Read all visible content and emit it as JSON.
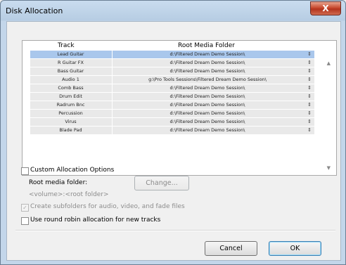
{
  "window": {
    "title": "Disk Allocation",
    "close_symbol": "X"
  },
  "table": {
    "col_track": "Track",
    "col_folder": "Root Media Folder",
    "rows": [
      {
        "track": "Lead Guitar",
        "folder": "d:\\Filtered Dream Demo Session\\",
        "selected": true
      },
      {
        "track": "R Guitar FX",
        "folder": "d:\\Filtered Dream Demo Session\\"
      },
      {
        "track": "Bass Guitar",
        "folder": "d:\\Filtered Dream Demo Session\\"
      },
      {
        "track": "Audio 1",
        "folder": "g:\\Pro Tools Sessions\\Filtered Dream Demo Session\\"
      },
      {
        "track": "Comb Bass",
        "folder": "d:\\Filtered Dream Demo Session\\"
      },
      {
        "track": "Drum Edit",
        "folder": "d:\\Filtered Dream Demo Session\\"
      },
      {
        "track": "Radrum Bnc",
        "folder": "d:\\Filtered Dream Demo Session\\"
      },
      {
        "track": "Percussion",
        "folder": "d:\\Filtered Dream Demo Session\\"
      },
      {
        "track": "Virus",
        "folder": "d:\\Filtered Dream Demo Session\\"
      },
      {
        "track": "Blade Pad",
        "folder": "d:\\Filtered Dream Demo Session\\"
      }
    ],
    "selector_symbol": "⇕",
    "scroll_up_symbol": "▲",
    "scroll_down_symbol": "▼"
  },
  "options": {
    "custom_label": "Custom Allocation Options",
    "root_folder_label": "Root media folder:",
    "change_button": "Change...",
    "volume_placeholder": "<volume>:<root folder>",
    "subfolders_label": "Create subfolders for audio, video, and fade files",
    "subfolders_check": "✓",
    "round_robin_label": "Use round robin allocation for new tracks"
  },
  "buttons": {
    "cancel": "Cancel",
    "ok": "OK"
  }
}
